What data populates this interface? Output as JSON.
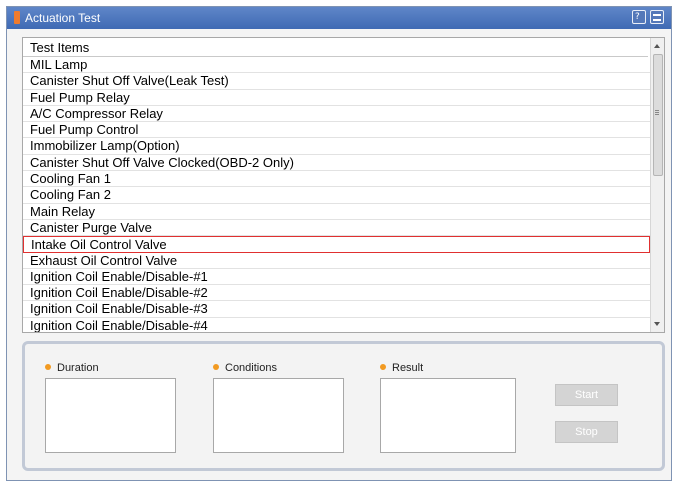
{
  "window": {
    "title": "Actuation Test"
  },
  "list": {
    "header": "Test Items",
    "items": [
      "MIL Lamp",
      "Canister Shut Off Valve(Leak Test)",
      "Fuel Pump Relay",
      "A/C Compressor Relay",
      "Fuel Pump Control",
      "Immobilizer Lamp(Option)",
      "Canister Shut Off Valve Clocked(OBD-2 Only)",
      "Cooling Fan 1",
      "Cooling Fan 2",
      "Main Relay",
      "Canister Purge Valve",
      "Intake Oil Control Valve",
      "Exhaust Oil Control Valve",
      "Ignition Coil Enable/Disable-#1",
      "Ignition Coil Enable/Disable-#2",
      "Ignition Coil Enable/Disable-#3",
      "Ignition Coil Enable/Disable-#4"
    ],
    "selected_index": 11
  },
  "panel": {
    "duration_label": "Duration",
    "conditions_label": "Conditions",
    "result_label": "Result",
    "start_label": "Start",
    "stop_label": "Stop"
  },
  "colors": {
    "title_bar": "#4a75be",
    "selection_border": "#e03030",
    "bullet": "#f29a21"
  }
}
